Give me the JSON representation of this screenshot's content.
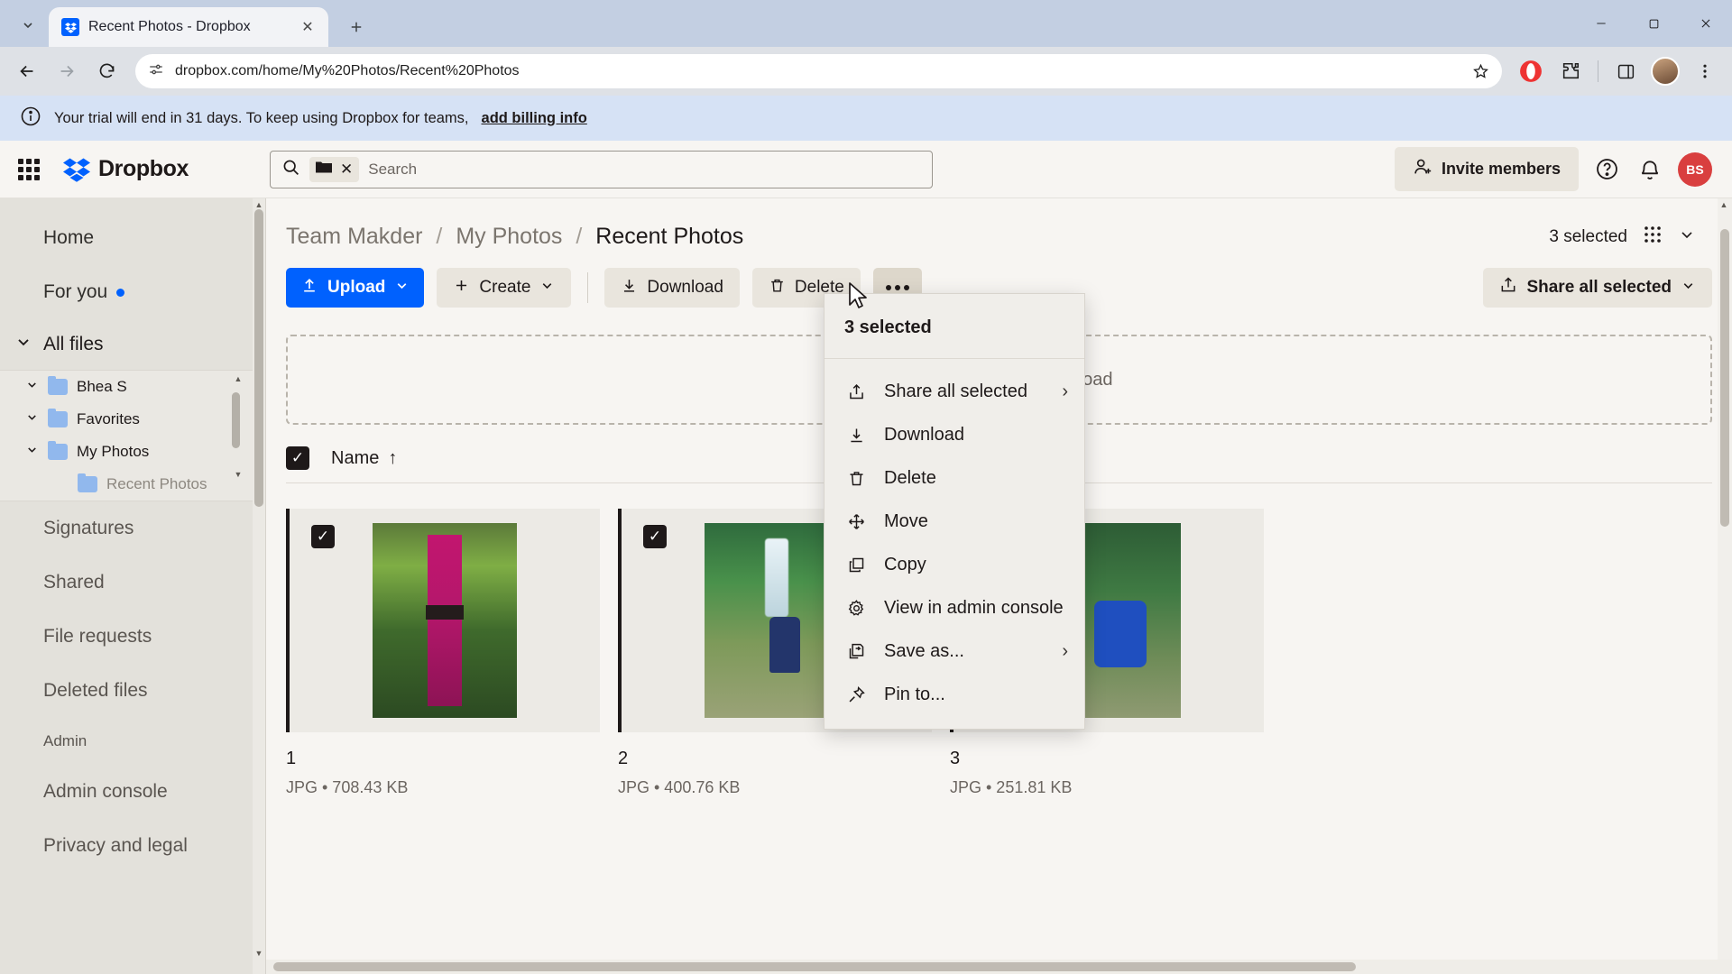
{
  "browser": {
    "tab": {
      "title": "Recent Photos - Dropbox",
      "favicon": "dropbox-icon",
      "close": "✕"
    },
    "new_tab_label": "+",
    "tab_list_icon": "chevron-down-icon",
    "window_controls": {
      "minimize": "—",
      "maximize": "☐",
      "close": "✕"
    },
    "nav": {
      "back": "←",
      "forward": "→",
      "reload": "↻"
    },
    "omnibox": {
      "url": "dropbox.com/home/My%20Photos/Recent%20Photos",
      "site_info_icon": "tune-icon",
      "star_icon": "bookmark-star-icon"
    },
    "extensions": {
      "opera_icon": "opera-extension-icon",
      "puzzle_icon": "extensions-icon",
      "sidepanel_icon": "side-panel-icon",
      "menu_icon": "three-dot-menu-icon"
    }
  },
  "banner": {
    "icon": "info-icon",
    "text": "Your trial will end in 31 days. To keep using Dropbox for teams,",
    "link": "add billing info"
  },
  "header": {
    "grid_icon": "app-grid-icon",
    "logo_text": "Dropbox",
    "search": {
      "icon": "search-icon",
      "chip_icon": "folder-icon",
      "chip_clear": "✕",
      "placeholder": "Search",
      "value": ""
    },
    "invite_label": "Invite members",
    "invite_icon": "add-person-icon",
    "help_icon": "help-circle-icon",
    "bell_icon": "notification-bell-icon",
    "user_initials": "BS"
  },
  "sidebar": {
    "items": [
      {
        "label": "Home",
        "name": "sidebar-item-home"
      },
      {
        "label": "For you",
        "name": "sidebar-item-for-you",
        "dot": true
      }
    ],
    "all_files": {
      "label": "All files",
      "chevron": "chevron-down-icon"
    },
    "tree": [
      {
        "label": "Bhea S",
        "name": "tree-item-bhea-s",
        "chevron": "chevron-down-icon"
      },
      {
        "label": "Favorites",
        "name": "tree-item-favorites",
        "chevron": "chevron-down-icon"
      },
      {
        "label": "My Photos",
        "name": "tree-item-my-photos",
        "chevron": "chevron-down-icon"
      },
      {
        "label": "Recent Photos",
        "name": "tree-item-recent-photos",
        "sub": true
      }
    ],
    "links": [
      {
        "label": "Signatures",
        "name": "sidebar-item-signatures"
      },
      {
        "label": "Shared",
        "name": "sidebar-item-shared"
      },
      {
        "label": "File requests",
        "name": "sidebar-item-file-requests"
      },
      {
        "label": "Deleted files",
        "name": "sidebar-item-deleted-files"
      }
    ],
    "admin_section": "Admin",
    "admin_links": [
      {
        "label": "Admin console",
        "name": "sidebar-item-admin-console"
      },
      {
        "label": "Privacy and legal",
        "name": "sidebar-item-privacy-and-legal"
      }
    ]
  },
  "main": {
    "breadcrumb": {
      "team": "Team Makder",
      "folder": "My Photos",
      "current": "Recent Photos",
      "sep": "/"
    },
    "selected_count": "3 selected",
    "view_icon": "grid-view-icon",
    "view_chevron": "chevron-down-icon",
    "toolbar": {
      "upload": "Upload",
      "upload_icon": "upload-arrow-icon",
      "upload_chevron": "chevron-down-icon",
      "create": "Create",
      "create_icon": "plus-icon",
      "download": "Download",
      "download_icon": "download-arrow-icon",
      "delete": "Delete",
      "delete_icon": "trash-icon",
      "more_icon": "three-dot-icon",
      "share_all": "Share all selected",
      "share_all_icon": "share-icon",
      "share_all_chevron": "chevron-down-icon"
    },
    "dropzone": {
      "icon": "upload-arrow-icon",
      "text": "Drop files here to upload"
    },
    "list_header": {
      "checkbox": "✓",
      "name_column": "Name",
      "sort_icon": "↑"
    },
    "files": [
      {
        "name": "1",
        "meta": "JPG • 708.43 KB",
        "selected": true,
        "art": "ph1"
      },
      {
        "name": "2",
        "meta": "JPG • 400.76 KB",
        "selected": true,
        "art": "ph2"
      },
      {
        "name": "3",
        "meta": "JPG • 251.81 KB",
        "selected": true,
        "art": "ph3"
      }
    ]
  },
  "context_menu": {
    "title": "3 selected",
    "items": [
      {
        "label": "Share all selected",
        "icon": "share-icon",
        "submenu": true
      },
      {
        "label": "Download",
        "icon": "download-arrow-icon",
        "submenu": false
      },
      {
        "label": "Delete",
        "icon": "trash-icon",
        "submenu": false
      },
      {
        "label": "Move",
        "icon": "move-arrows-icon",
        "submenu": false
      },
      {
        "label": "Copy",
        "icon": "copy-icon",
        "submenu": false
      },
      {
        "label": "View in admin console",
        "icon": "gear-icon",
        "submenu": false
      },
      {
        "label": "Save as...",
        "icon": "save-as-icon",
        "submenu": true
      },
      {
        "label": "Pin to...",
        "icon": "pin-icon",
        "submenu": false
      }
    ],
    "chevron": "›"
  },
  "colors": {
    "accent": "#0061fe",
    "banner_bg": "#d6e2f5",
    "surface": "#f7f5f2",
    "sidebar": "#e3e1db"
  }
}
